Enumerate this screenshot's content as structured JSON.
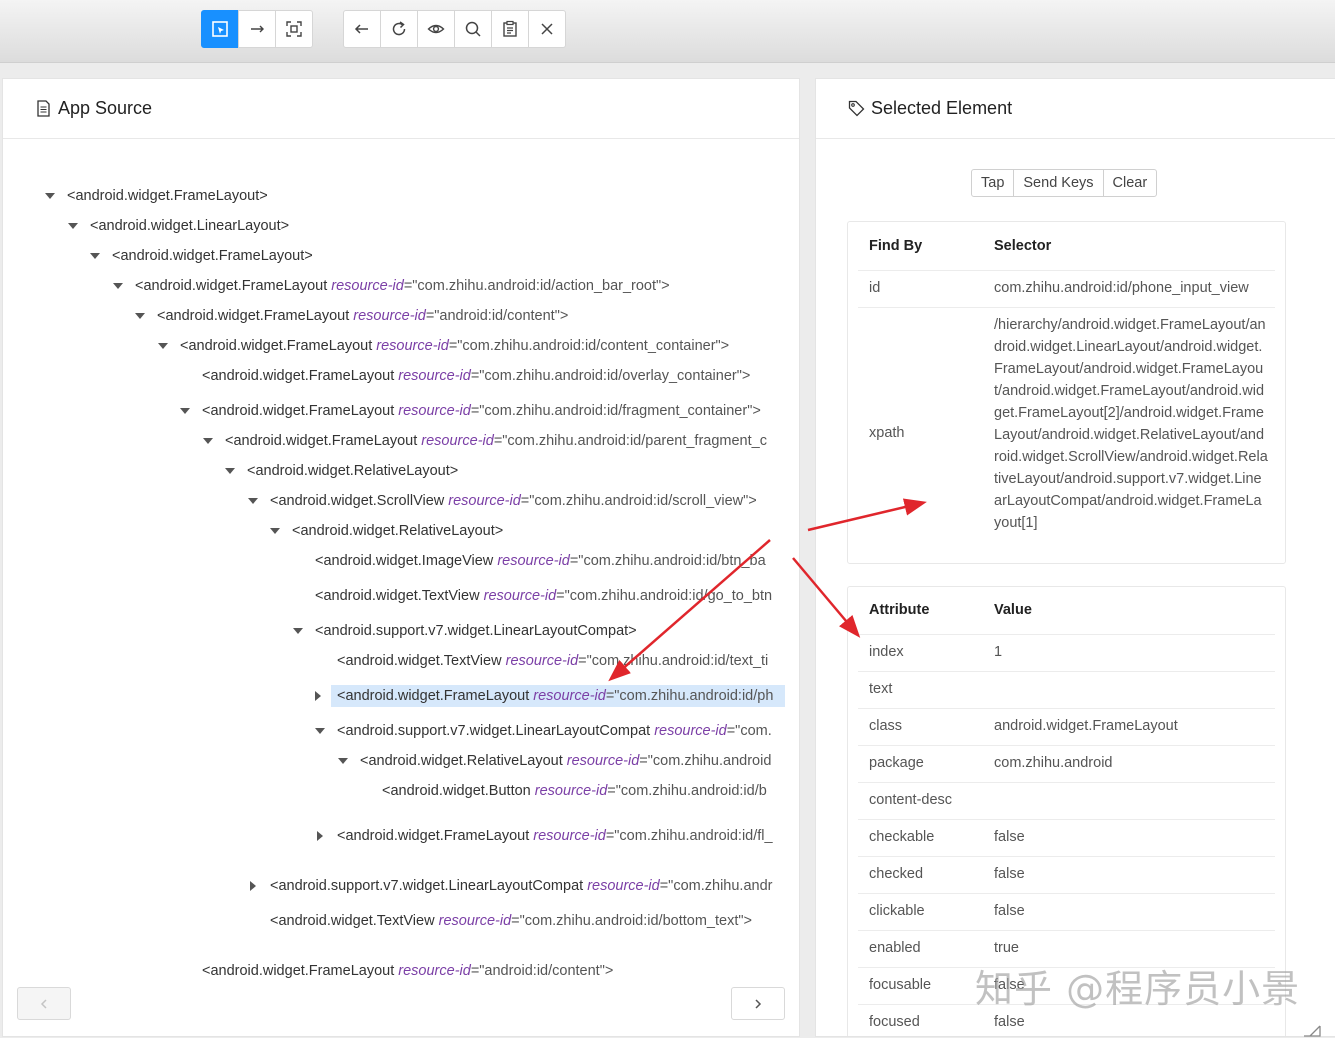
{
  "toolbar": {
    "group1": [
      "select-element-icon",
      "swipe-icon",
      "screenshot-area-icon"
    ],
    "group2": [
      "back-icon",
      "refresh-icon",
      "eye-icon",
      "search-icon",
      "clipboard-icon",
      "close-icon"
    ]
  },
  "left_panel": {
    "title": "App Source",
    "tree": [
      {
        "tag": "<android.widget.FrameLayout>",
        "attr": "",
        "val": "",
        "caret": "down"
      },
      {
        "tag": "<android.widget.LinearLayout>",
        "attr": "",
        "val": "",
        "caret": "down"
      },
      {
        "tag": "<android.widget.FrameLayout>",
        "attr": "",
        "val": "",
        "caret": "down"
      },
      {
        "tag": "<android.widget.FrameLayout ",
        "attr": "resource-id",
        "val": "=\"com.zhihu.android:id/action_bar_root\">",
        "caret": "down"
      },
      {
        "tag": "<android.widget.FrameLayout ",
        "attr": "resource-id",
        "val": "=\"android:id/content\">",
        "caret": "down"
      },
      {
        "tag": "<android.widget.FrameLayout ",
        "attr": "resource-id",
        "val": "=\"com.zhihu.android:id/content_container\">",
        "caret": "down"
      },
      {
        "tag": "<android.widget.FrameLayout ",
        "attr": "resource-id",
        "val": "=\"com.zhihu.android:id/overlay_container\">",
        "caret": ""
      },
      {
        "tag": "<android.widget.FrameLayout ",
        "attr": "resource-id",
        "val": "=\"com.zhihu.android:id/fragment_container\">",
        "caret": "down"
      },
      {
        "tag": "<android.widget.FrameLayout ",
        "attr": "resource-id",
        "val": "=\"com.zhihu.android:id/parent_fragment_c",
        "caret": "down"
      },
      {
        "tag": "<android.widget.RelativeLayout>",
        "attr": "",
        "val": "",
        "caret": "down"
      },
      {
        "tag": "<android.widget.ScrollView ",
        "attr": "resource-id",
        "val": "=\"com.zhihu.android:id/scroll_view\">",
        "caret": "down"
      },
      {
        "tag": "<android.widget.RelativeLayout>",
        "attr": "",
        "val": "",
        "caret": "down"
      },
      {
        "tag": "<android.widget.ImageView ",
        "attr": "resource-id",
        "val": "=\"com.zhihu.android:id/btn_ba",
        "caret": ""
      },
      {
        "tag": "<android.widget.TextView ",
        "attr": "resource-id",
        "val": "=\"com.zhihu.android:id/go_to_btn",
        "caret": ""
      },
      {
        "tag": "<android.support.v7.widget.LinearLayoutCompat>",
        "attr": "",
        "val": "",
        "caret": "down"
      },
      {
        "tag": "<android.widget.TextView ",
        "attr": "resource-id",
        "val": "=\"com.zhihu.android:id/text_ti",
        "caret": ""
      },
      {
        "tag": "<android.widget.FrameLayout ",
        "attr": "resource-id",
        "val": "=\"com.zhihu.android:id/ph",
        "caret": "right"
      },
      {
        "tag": "<android.support.v7.widget.LinearLayoutCompat ",
        "attr": "resource-id",
        "val": "=\"com.",
        "caret": "down"
      },
      {
        "tag": "<android.widget.RelativeLayout ",
        "attr": "resource-id",
        "val": "=\"com.zhihu.android",
        "caret": "down"
      },
      {
        "tag": "<android.widget.Button ",
        "attr": "resource-id",
        "val": "=\"com.zhihu.android:id/b",
        "caret": ""
      },
      {
        "tag": "<android.widget.FrameLayout ",
        "attr": "resource-id",
        "val": "=\"com.zhihu.android:id/fl_",
        "caret": "right"
      },
      {
        "tag": "<android.support.v7.widget.LinearLayoutCompat ",
        "attr": "resource-id",
        "val": "=\"com.zhihu.andr",
        "caret": "right"
      },
      {
        "tag": "<android.widget.TextView ",
        "attr": "resource-id",
        "val": "=\"com.zhihu.android:id/bottom_text\">",
        "caret": ""
      },
      {
        "tag": "<android.widget.FrameLayout ",
        "attr": "resource-id",
        "val": "=\"android:id/content\">",
        "caret": ""
      }
    ]
  },
  "right_panel": {
    "title": "Selected Element",
    "actions": [
      "Tap",
      "Send Keys",
      "Clear"
    ],
    "selector_table": {
      "headers": [
        "Find By",
        "Selector"
      ],
      "rows": [
        {
          "key": "id",
          "value": "com.zhihu.android:id/phone_input_view"
        },
        {
          "key": "xpath",
          "value": "/hierarchy/android.widget.FrameLayout/android.widget.LinearLayout/android.widget.FrameLayout/android.widget.FrameLayout/android.widget.FrameLayout/android.widget.FrameLayout[2]/android.widget.FrameLayout/android.widget.RelativeLayout/android.widget.ScrollView/android.widget.RelativeLayout/android.support.v7.widget.LinearLayoutCompat/android.widget.FrameLayout[1]"
        }
      ]
    },
    "attribute_table": {
      "headers": [
        "Attribute",
        "Value"
      ],
      "rows": [
        {
          "key": "index",
          "value": "1"
        },
        {
          "key": "text",
          "value": ""
        },
        {
          "key": "class",
          "value": "android.widget.FrameLayout"
        },
        {
          "key": "package",
          "value": "com.zhihu.android"
        },
        {
          "key": "content-desc",
          "value": ""
        },
        {
          "key": "checkable",
          "value": "false"
        },
        {
          "key": "checked",
          "value": "false"
        },
        {
          "key": "clickable",
          "value": "false"
        },
        {
          "key": "enabled",
          "value": "true"
        },
        {
          "key": "focusable",
          "value": "false"
        },
        {
          "key": "focused",
          "value": "false"
        }
      ]
    }
  },
  "watermark": "知乎 @程序员小景",
  "colors": {
    "accent": "#1890ff",
    "selected_row": "#d6e8fb",
    "arrow": "#e0262c",
    "attr_name": "#7b3fa6"
  }
}
